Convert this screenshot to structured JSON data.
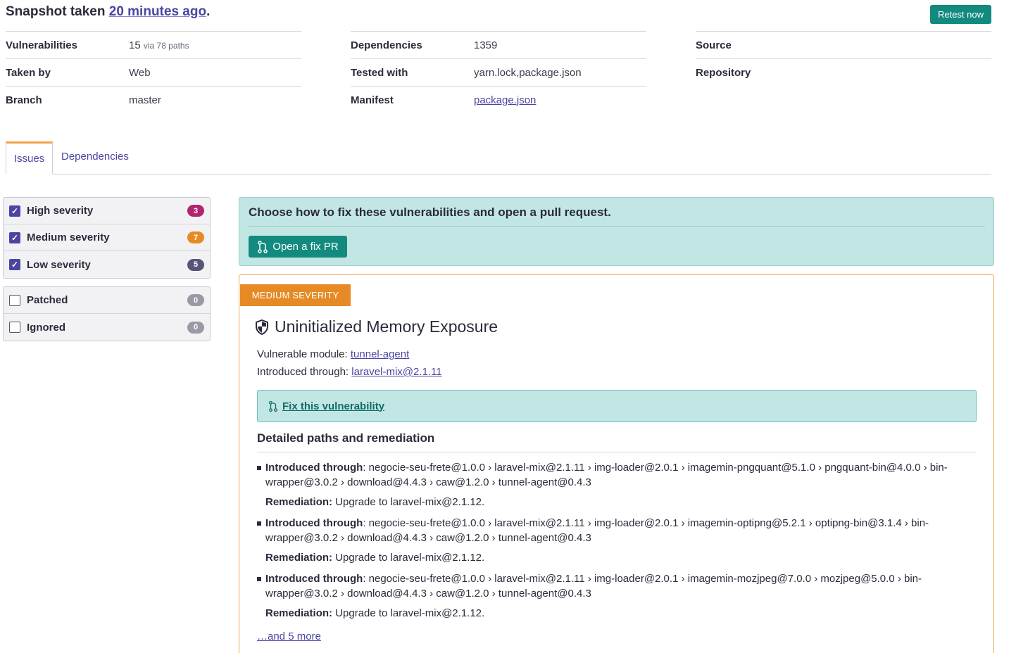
{
  "header": {
    "prefix": "Snapshot taken ",
    "time_link": "20 minutes ago",
    "suffix": ".",
    "retest_label": "Retest now"
  },
  "meta": {
    "col1": [
      {
        "key": "Vulnerabilities",
        "value": "15",
        "sub": "via 78 paths"
      },
      {
        "key": "Taken by",
        "value": "Web"
      },
      {
        "key": "Branch",
        "value": "master"
      }
    ],
    "col2": [
      {
        "key": "Dependencies",
        "value": "1359"
      },
      {
        "key": "Tested with",
        "value": "yarn.lock,package.json"
      },
      {
        "key": "Manifest",
        "value": "package.json"
      }
    ],
    "col3": [
      {
        "key": "Source",
        "value": ""
      },
      {
        "key": "Repository",
        "value": ""
      }
    ]
  },
  "tabs": {
    "issues": "Issues",
    "dependencies": "Dependencies"
  },
  "filters": {
    "severity": [
      {
        "label": "High severity",
        "count": "3",
        "checked": true,
        "color": "#b3246f"
      },
      {
        "label": "Medium severity",
        "count": "7",
        "checked": true,
        "color": "#e68a25"
      },
      {
        "label": "Low severity",
        "count": "5",
        "checked": true,
        "color": "#55557a"
      }
    ],
    "status": [
      {
        "label": "Patched",
        "count": "0",
        "checked": false,
        "color": "#9a9aa6"
      },
      {
        "label": "Ignored",
        "count": "0",
        "checked": false,
        "color": "#9a9aa6"
      }
    ]
  },
  "fix_banner": {
    "heading": "Choose how to fix these vulnerabilities and open a pull request.",
    "button_label": "Open a fix PR"
  },
  "issue": {
    "severity_label": "MEDIUM SEVERITY",
    "title": "Uninitialized Memory Exposure",
    "module_label": "Vulnerable module: ",
    "module": "tunnel-agent",
    "intro_label": "Introduced through: ",
    "intro": "laravel-mix@2.1.11",
    "fix_link": "Fix this vulnerability",
    "paths_heading": "Detailed paths and remediation",
    "paths": [
      {
        "label": "Introduced through",
        "path": ": negocie-seu-frete@1.0.0 › laravel-mix@2.1.11 › img-loader@2.0.1 › imagemin-pngquant@5.1.0 › pngquant-bin@4.0.0 › bin-wrapper@3.0.2 › download@4.4.3 › caw@1.2.0 › tunnel-agent@0.4.3",
        "remed_label": "Remediation:",
        "remed": " Upgrade to laravel-mix@2.1.12."
      },
      {
        "label": "Introduced through",
        "path": ": negocie-seu-frete@1.0.0 › laravel-mix@2.1.11 › img-loader@2.0.1 › imagemin-optipng@5.2.1 › optipng-bin@3.1.4 › bin-wrapper@3.0.2 › download@4.4.3 › caw@1.2.0 › tunnel-agent@0.4.3",
        "remed_label": "Remediation:",
        "remed": " Upgrade to laravel-mix@2.1.12."
      },
      {
        "label": "Introduced through",
        "path": ": negocie-seu-frete@1.0.0 › laravel-mix@2.1.11 › img-loader@2.0.1 › imagemin-mozjpeg@7.0.0 › mozjpeg@5.0.0 › bin-wrapper@3.0.2 › download@4.4.3 › caw@1.2.0 › tunnel-agent@0.4.3",
        "remed_label": "Remediation:",
        "remed": " Upgrade to laravel-mix@2.1.12."
      }
    ],
    "more_link": "…and 5 more"
  }
}
